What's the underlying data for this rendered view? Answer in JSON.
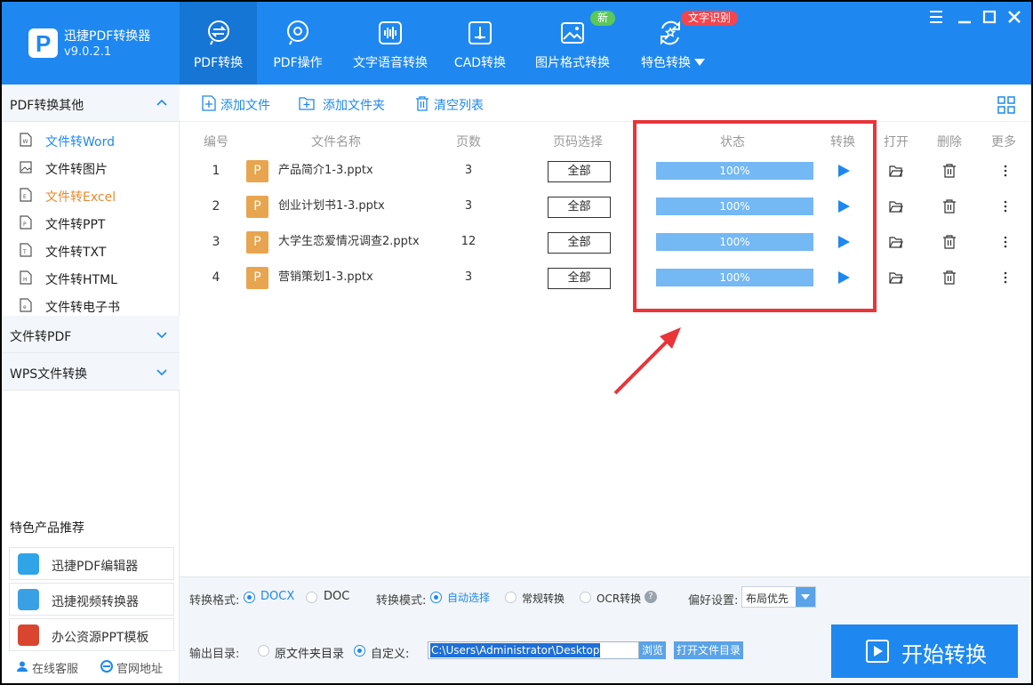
{
  "app": {
    "title": "迅捷PDF转换器",
    "version": "v9.0.2.1"
  },
  "nav": [
    {
      "label": "PDF转换",
      "icon": "pdf-convert-icon"
    },
    {
      "label": "PDF操作",
      "icon": "pdf-operate-icon"
    },
    {
      "label": "文字语音转换",
      "icon": "audio-wave-icon"
    },
    {
      "label": "CAD转换",
      "icon": "cad-icon"
    },
    {
      "label": "图片格式转换",
      "icon": "image-icon"
    },
    {
      "label": "特色转换",
      "icon": "special-convert-icon"
    }
  ],
  "badges": {
    "new": "新",
    "ocr": "文字识别"
  },
  "sidebar": {
    "section1": "PDF转换其他",
    "items": [
      {
        "label": "文件转Word"
      },
      {
        "label": "文件转图片"
      },
      {
        "label": "文件转Excel"
      },
      {
        "label": "文件转PPT"
      },
      {
        "label": "文件转TXT"
      },
      {
        "label": "文件转HTML"
      },
      {
        "label": "文件转电子书"
      }
    ],
    "section2": "文件转PDF",
    "section3": "WPS文件转换",
    "recommend_title": "特色产品推荐",
    "recommend": [
      {
        "label": "迅捷PDF编辑器"
      },
      {
        "label": "迅捷视频转换器"
      },
      {
        "label": "办公资源PPT模板"
      }
    ],
    "footer": {
      "service": "在线客服",
      "website": "官网地址"
    }
  },
  "toolbar": {
    "add_file": "添加文件",
    "add_folder": "添加文件夹",
    "clear_list": "清空列表"
  },
  "table": {
    "headers": {
      "num": "编号",
      "name": "文件名称",
      "pages": "页数",
      "range": "页码选择",
      "status": "状态",
      "convert": "转换",
      "open": "打开",
      "delete": "删除",
      "more": "更多"
    },
    "file_icon_letter": "P",
    "rows": [
      {
        "num": "1",
        "name": "产品简介1-3.pptx",
        "pages": "3",
        "range": "全部",
        "progress": "100%"
      },
      {
        "num": "2",
        "name": "创业计划书1-3.pptx",
        "pages": "3",
        "range": "全部",
        "progress": "100%"
      },
      {
        "num": "3",
        "name": "大学生恋爱情况调查2.pptx",
        "pages": "12",
        "range": "全部",
        "progress": "100%"
      },
      {
        "num": "4",
        "name": "营销策划1-3.pptx",
        "pages": "3",
        "range": "全部",
        "progress": "100%"
      }
    ]
  },
  "options": {
    "format_label": "转换格式:",
    "format_docx": "DOCX",
    "format_doc": "DOC",
    "mode_label": "转换模式:",
    "mode_auto": "自动选择",
    "mode_normal": "常规转换",
    "mode_ocr": "OCR转换",
    "pref_label": "偏好设置:",
    "pref_value": "布局优先",
    "output_label": "输出目录:",
    "output_source": "原文件夹目录",
    "output_custom": "自定义:",
    "output_path": "C:\\Users\\Administrator\\Desktop",
    "browse": "浏览",
    "open_folder": "打开文件目录",
    "start": "开始转换"
  },
  "colors": {
    "brand": "#1e88f0",
    "highlight": "#e9343a",
    "progress": "#74b8f4",
    "file_icon": "#e8a54f"
  }
}
